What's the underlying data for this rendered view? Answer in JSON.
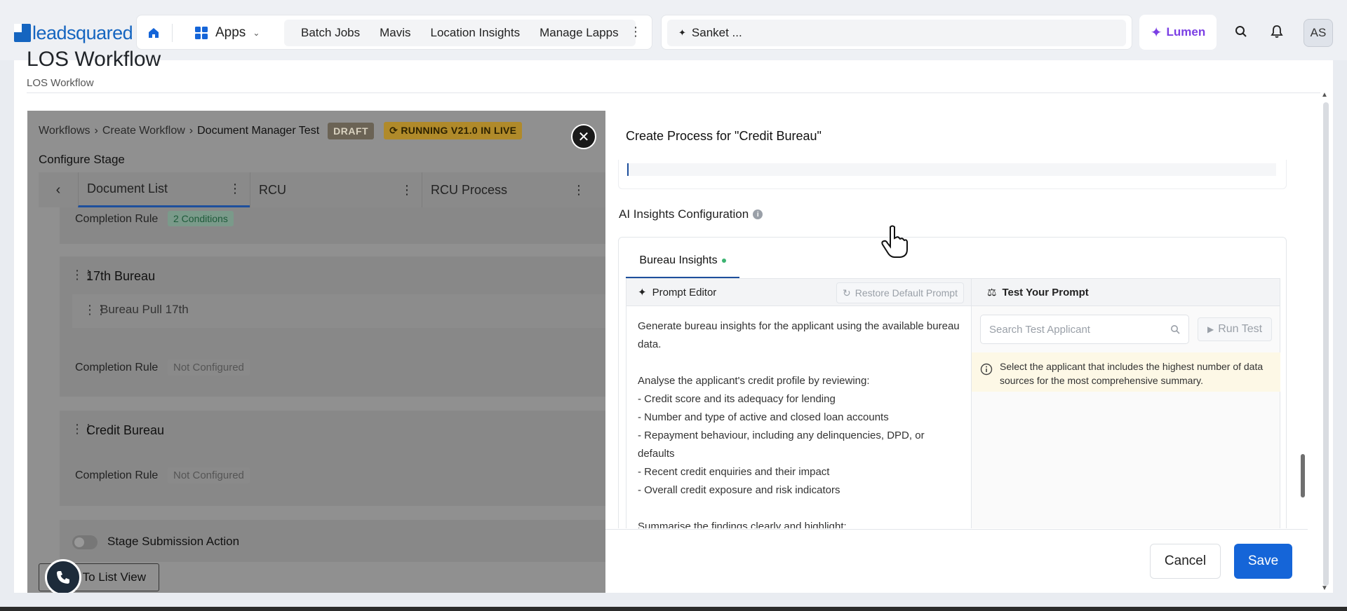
{
  "nav": {
    "logo_text": "leadsquared",
    "apps_label": "Apps",
    "links": [
      "Batch Jobs",
      "Mavis",
      "Location Insights",
      "Manage Lapps"
    ],
    "search_text": "Sanket ...",
    "lumen_label": "Lumen",
    "avatar_initials": "AS"
  },
  "page": {
    "title": "LOS Workflow",
    "subtitle": "LOS Workflow"
  },
  "workflow": {
    "breadcrumbs": [
      "Workflows",
      "Create Workflow",
      "Document Manager Test"
    ],
    "draft_badge": "DRAFT",
    "running_badge": "RUNNING V21.0 IN LIVE",
    "configure_stage": "Configure Stage",
    "stage_tabs": [
      "Document List",
      "RCU",
      "RCU Process"
    ],
    "completion_rule_label": "Completion Rule",
    "conditions_chip": "2 Conditions",
    "not_configured": "Not Configured",
    "section_17th": "17th Bureau",
    "bureau_pull": "Bureau Pull 17th",
    "section_credit": "Credit Bureau",
    "stage_submission": "Stage Submission Action",
    "list_view_btn": "To List View"
  },
  "modal": {
    "title": "Create Process for \"Credit Bureau\"",
    "ai_title": "AI Insights Configuration",
    "tab_label": "Bureau Insights",
    "prompt_editor": "Prompt Editor",
    "restore_label": "Restore Default Prompt",
    "prompt_text": "Generate bureau insights for the applicant using the available bureau data.\n\nAnalyse the applicant's credit profile by reviewing:\n- Credit score and its adequacy for lending\n- Number and type of active and closed loan accounts\n- Repayment behaviour, including any delinquencies, DPD, or defaults\n- Recent credit enquiries and their impact\n- Overall credit exposure and risk indicators\n\nSummarise the findings clearly and highlight:",
    "test_label": "Test Your Prompt",
    "search_placeholder": "Search Test Applicant",
    "run_test": "Run Test",
    "note": "Select the applicant that includes the highest number of data sources for the most comprehensive summary.",
    "cancel": "Cancel",
    "save": "Save"
  },
  "colors": {
    "brand": "#1565c0",
    "primary_button": "#1565d8",
    "lumen": "#7b3fe4",
    "draft_badge": "#6b6355",
    "running_badge": "#b08a2a"
  }
}
